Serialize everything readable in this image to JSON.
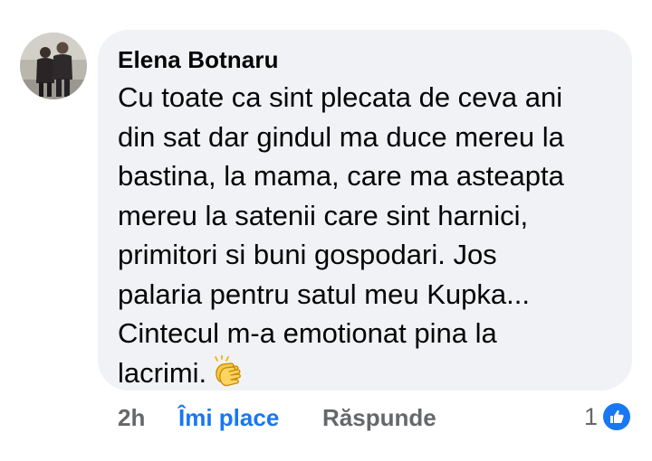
{
  "comment": {
    "author": "Elena Botnaru",
    "text_lines": [
      "Cu toate ca sint plecata de ceva ani",
      "din sat dar gindul ma duce mereu la",
      "bastina, la mama, care ma asteapta",
      "mereu la satenii care sint harnici,",
      "primitori si buni gospodari. Jos",
      "palaria pentru satul meu Kupka...",
      "Cintecul m-a emotionat pina la",
      "lacrimi."
    ],
    "emoji": "clapping-hands"
  },
  "actions": {
    "time": "2h",
    "like_label": "Îmi place",
    "reply_label": "Răspunde",
    "reaction_count": "1",
    "reaction_icon": "like-thumbs-up-icon"
  },
  "colors": {
    "bubble_bg": "#f0f2f5",
    "text": "#050505",
    "secondary": "#65676b",
    "like_blue": "#1877f2"
  }
}
